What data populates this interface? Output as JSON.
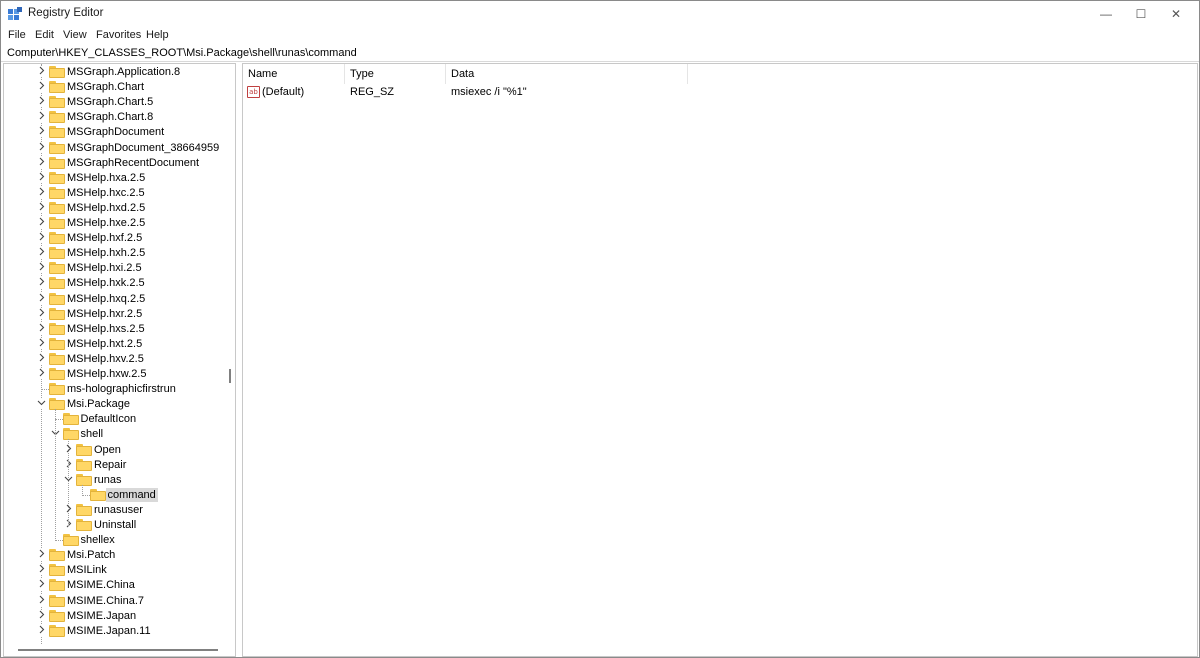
{
  "window": {
    "title": "Registry Editor",
    "controls": {
      "minimize": "—",
      "maximize": "☐",
      "close": "✕"
    }
  },
  "menu": [
    "File",
    "Edit",
    "View",
    "Favorites",
    "Help"
  ],
  "address": "Computer\\HKEY_CLASSES_ROOT\\Msi.Package\\shell\\runas\\command",
  "tree": {
    "items": [
      {
        "label": "MSGraph.Application.8",
        "level": 0,
        "expander": "collapsed"
      },
      {
        "label": "MSGraph.Chart",
        "level": 0,
        "expander": "collapsed"
      },
      {
        "label": "MSGraph.Chart.5",
        "level": 0,
        "expander": "collapsed"
      },
      {
        "label": "MSGraph.Chart.8",
        "level": 0,
        "expander": "collapsed"
      },
      {
        "label": "MSGraphDocument",
        "level": 0,
        "expander": "collapsed"
      },
      {
        "label": "MSGraphDocument_38664959",
        "level": 0,
        "expander": "collapsed"
      },
      {
        "label": "MSGraphRecentDocument",
        "level": 0,
        "expander": "collapsed"
      },
      {
        "label": "MSHelp.hxa.2.5",
        "level": 0,
        "expander": "collapsed"
      },
      {
        "label": "MSHelp.hxc.2.5",
        "level": 0,
        "expander": "collapsed"
      },
      {
        "label": "MSHelp.hxd.2.5",
        "level": 0,
        "expander": "collapsed"
      },
      {
        "label": "MSHelp.hxe.2.5",
        "level": 0,
        "expander": "collapsed"
      },
      {
        "label": "MSHelp.hxf.2.5",
        "level": 0,
        "expander": "collapsed"
      },
      {
        "label": "MSHelp.hxh.2.5",
        "level": 0,
        "expander": "collapsed"
      },
      {
        "label": "MSHelp.hxi.2.5",
        "level": 0,
        "expander": "collapsed"
      },
      {
        "label": "MSHelp.hxk.2.5",
        "level": 0,
        "expander": "collapsed"
      },
      {
        "label": "MSHelp.hxq.2.5",
        "level": 0,
        "expander": "collapsed"
      },
      {
        "label": "MSHelp.hxr.2.5",
        "level": 0,
        "expander": "collapsed"
      },
      {
        "label": "MSHelp.hxs.2.5",
        "level": 0,
        "expander": "collapsed"
      },
      {
        "label": "MSHelp.hxt.2.5",
        "level": 0,
        "expander": "collapsed"
      },
      {
        "label": "MSHelp.hxv.2.5",
        "level": 0,
        "expander": "collapsed"
      },
      {
        "label": "MSHelp.hxw.2.5",
        "level": 0,
        "expander": "collapsed"
      },
      {
        "label": "ms-holographicfirstrun",
        "level": 0,
        "expander": "none"
      },
      {
        "label": "Msi.Package",
        "level": 0,
        "expander": "expanded"
      },
      {
        "label": "DefaultIcon",
        "level": 1,
        "expander": "none"
      },
      {
        "label": "shell",
        "level": 1,
        "expander": "expanded"
      },
      {
        "label": "Open",
        "level": 2,
        "expander": "collapsed"
      },
      {
        "label": "Repair",
        "level": 2,
        "expander": "collapsed"
      },
      {
        "label": "runas",
        "level": 2,
        "expander": "expanded"
      },
      {
        "label": "command",
        "level": 3,
        "expander": "none",
        "selected": true
      },
      {
        "label": "runasuser",
        "level": 2,
        "expander": "collapsed"
      },
      {
        "label": "Uninstall",
        "level": 2,
        "expander": "collapsed"
      },
      {
        "label": "shellex",
        "level": 1,
        "expander": "none"
      },
      {
        "label": "Msi.Patch",
        "level": 0,
        "expander": "collapsed"
      },
      {
        "label": "MSILink",
        "level": 0,
        "expander": "collapsed"
      },
      {
        "label": "MSIME.China",
        "level": 0,
        "expander": "collapsed"
      },
      {
        "label": "MSIME.China.7",
        "level": 0,
        "expander": "collapsed"
      },
      {
        "label": "MSIME.Japan",
        "level": 0,
        "expander": "collapsed"
      },
      {
        "label": "MSIME.Japan.11",
        "level": 0,
        "expander": "collapsed"
      }
    ]
  },
  "values": {
    "columns": [
      "Name",
      "Type",
      "Data"
    ],
    "rows": [
      {
        "icon": "string-value-icon",
        "icon_text": "ab",
        "name": "(Default)",
        "type": "REG_SZ",
        "data": "msiexec /i \"%1\""
      }
    ]
  },
  "colors": {
    "folder": "#ffd766",
    "selection": "#d9d9d9",
    "string_icon": "#c04040"
  }
}
